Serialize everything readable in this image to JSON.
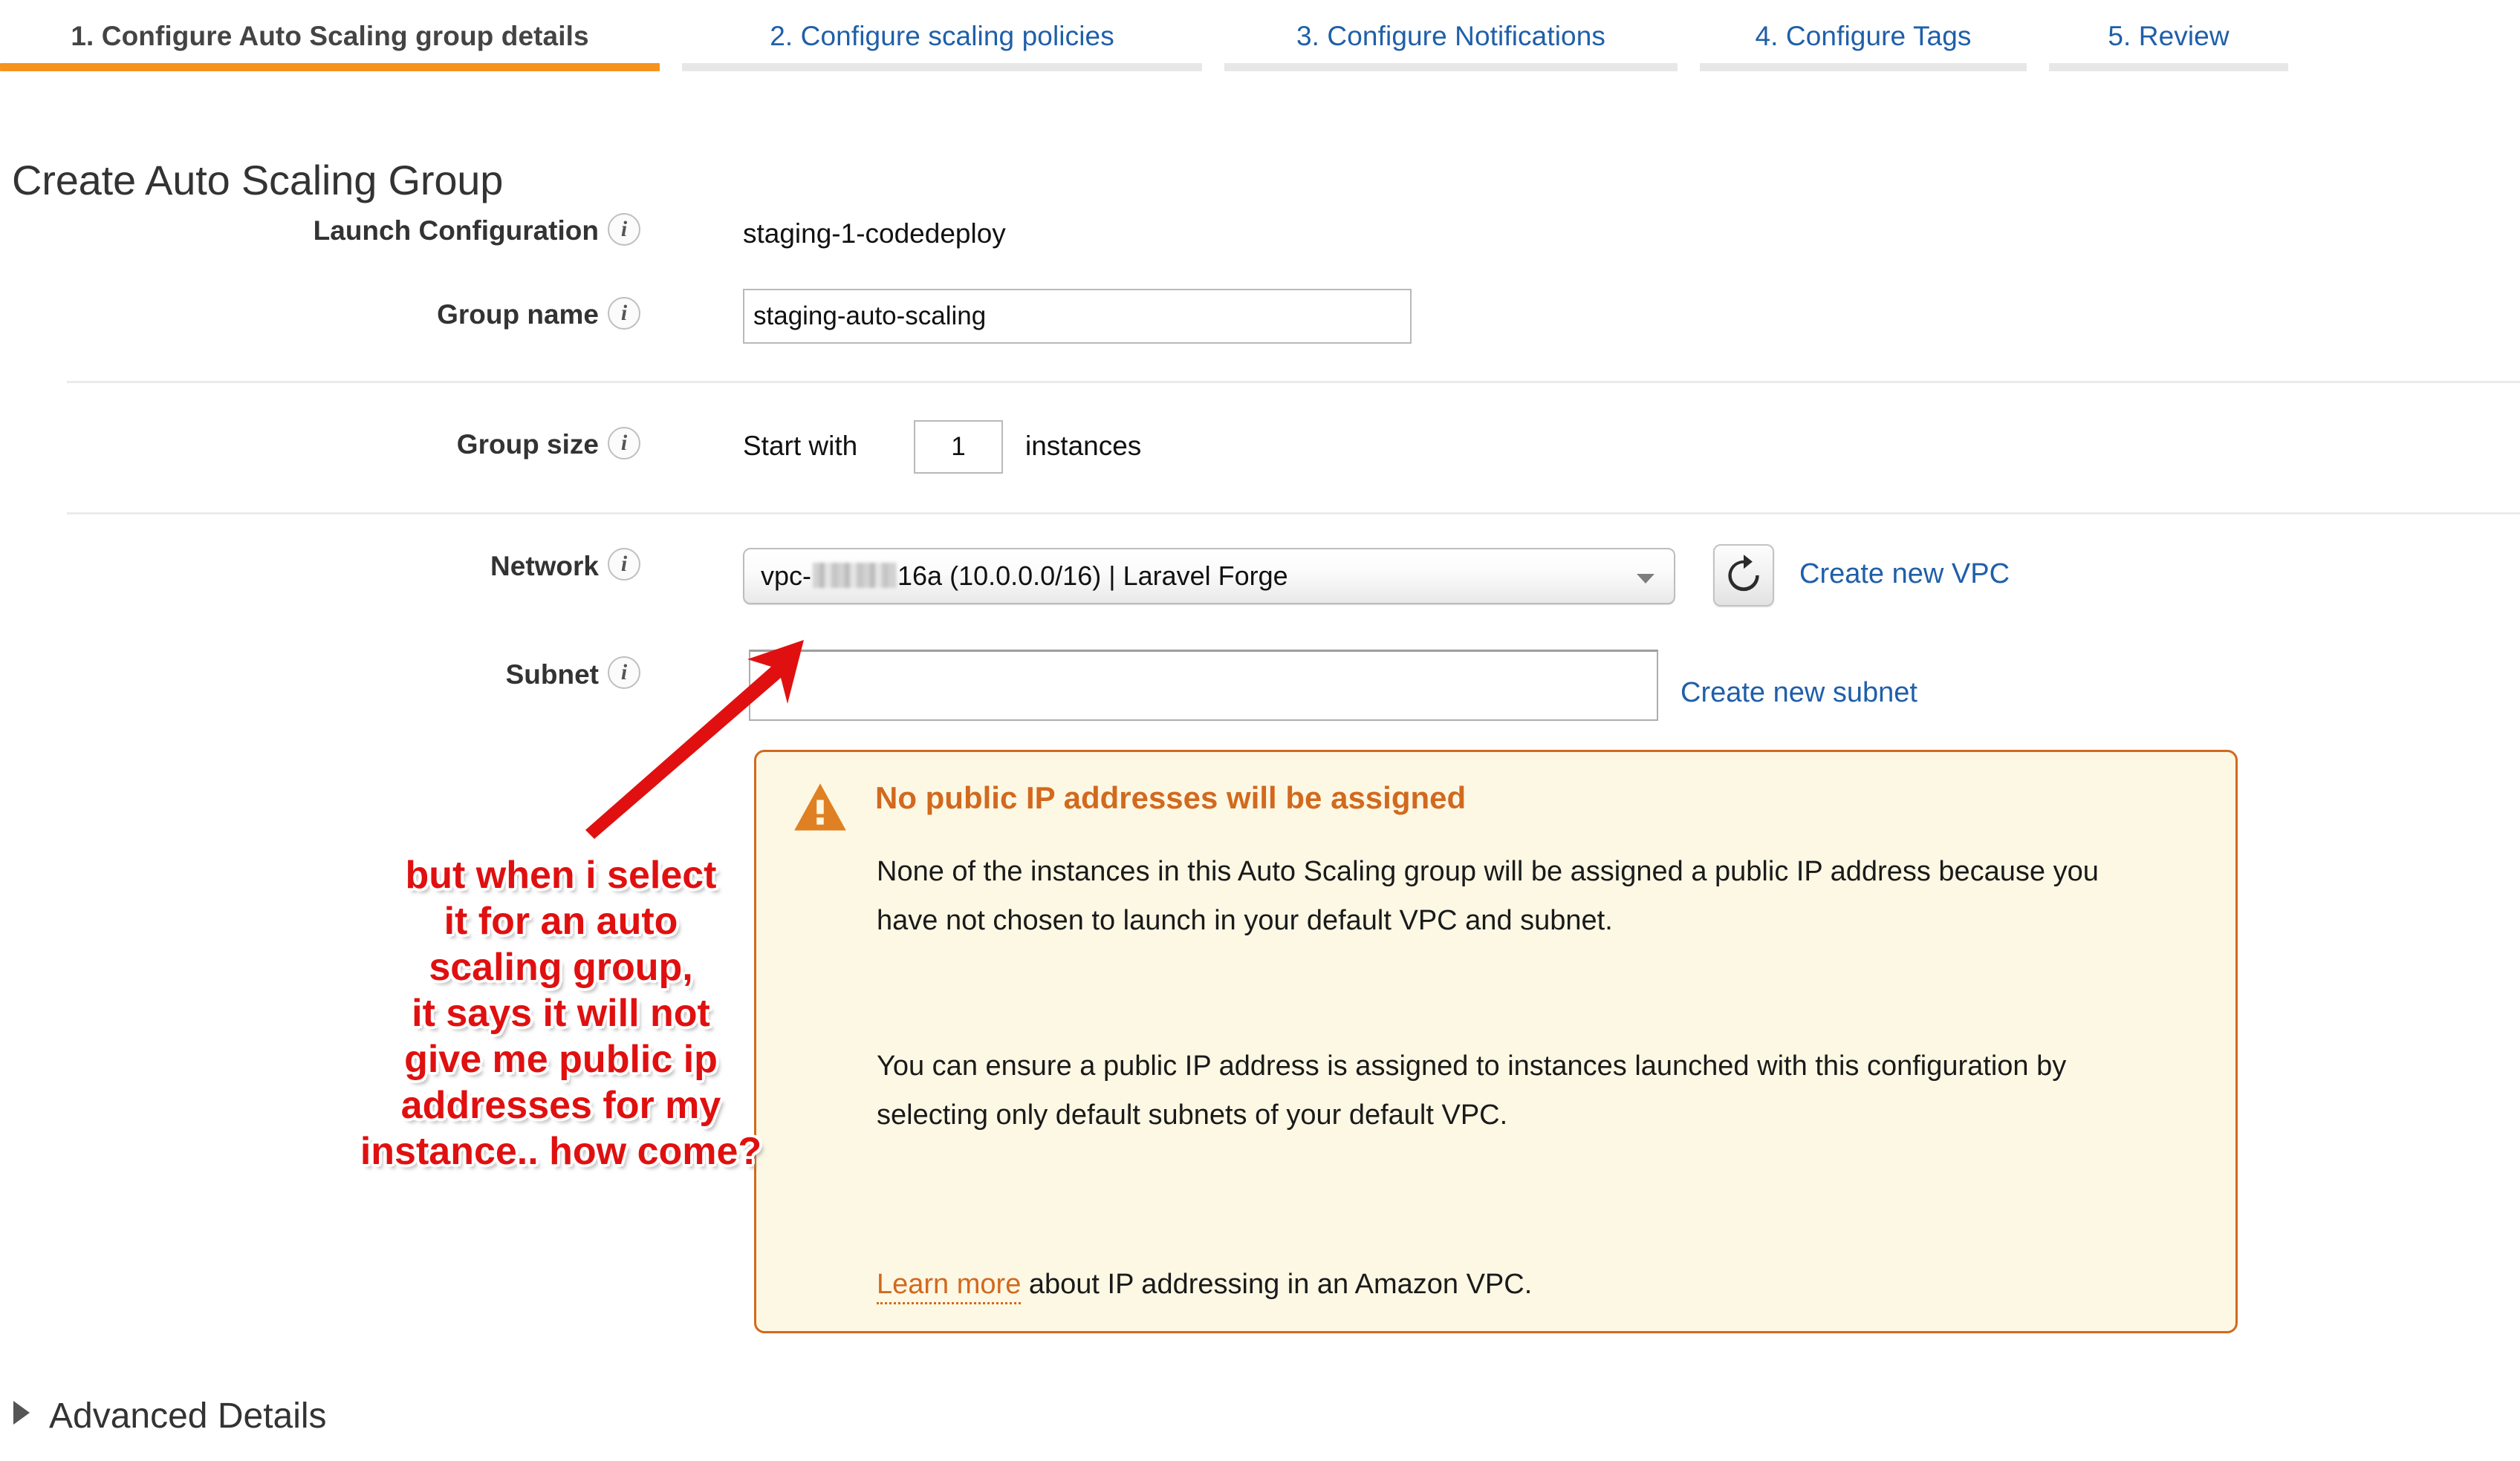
{
  "wizard": {
    "tabs": [
      {
        "label": "1. Configure Auto Scaling group details",
        "active": true
      },
      {
        "label": "2. Configure scaling policies",
        "active": false
      },
      {
        "label": "3. Configure Notifications",
        "active": false
      },
      {
        "label": "4. Configure Tags",
        "active": false
      },
      {
        "label": "5. Review",
        "active": false
      }
    ],
    "active_color": "#f6921e",
    "link_color": "#1f5fa9"
  },
  "page": {
    "title": "Create Auto Scaling Group"
  },
  "form": {
    "launch_configuration": {
      "label": "Launch Configuration",
      "info_icon": "info-icon",
      "value": "staging-1-codedeploy"
    },
    "group_name": {
      "label": "Group name",
      "info_icon": "info-icon",
      "value": "staging-auto-scaling",
      "placeholder": ""
    },
    "group_size": {
      "label": "Group size",
      "info_icon": "info-icon",
      "prefix": "Start with",
      "value": "1",
      "suffix": "instances"
    },
    "network": {
      "label": "Network",
      "info_icon": "info-icon",
      "value_prefix": "vpc-",
      "value_suffix": "16a (10.0.0.0/16) | Laravel Forge",
      "redacted": true,
      "refresh_icon": "refresh-icon",
      "create_link": "Create new VPC"
    },
    "subnet": {
      "label": "Subnet",
      "info_icon": "info-icon",
      "value": "",
      "create_link": "Create new subnet"
    }
  },
  "alert": {
    "icon": "warning-triangle-icon",
    "title": "No public IP addresses will be assigned",
    "paragraph_1": "None of the instances in this Auto Scaling group will be assigned a public IP address because you have not chosen to launch in your default VPC and subnet.",
    "paragraph_2": "You can ensure a public IP address is assigned to instances launched with this configuration by selecting only default subnets of your default VPC.",
    "learn_more_link": "Learn more",
    "learn_more_rest": " about IP addressing in an Amazon VPC.",
    "border_color": "#d2691e",
    "background_color": "#fdf8e4"
  },
  "annotation": {
    "arrow": "red-arrow",
    "color": "#e01010",
    "lines": [
      "but when i select",
      "it for an auto",
      "scaling group,",
      "it says it will not",
      "give me public ip",
      "addresses for my",
      "instance.. how come?"
    ]
  },
  "advanced_details": {
    "caret": "triangle-right-icon",
    "label": "Advanced Details"
  }
}
